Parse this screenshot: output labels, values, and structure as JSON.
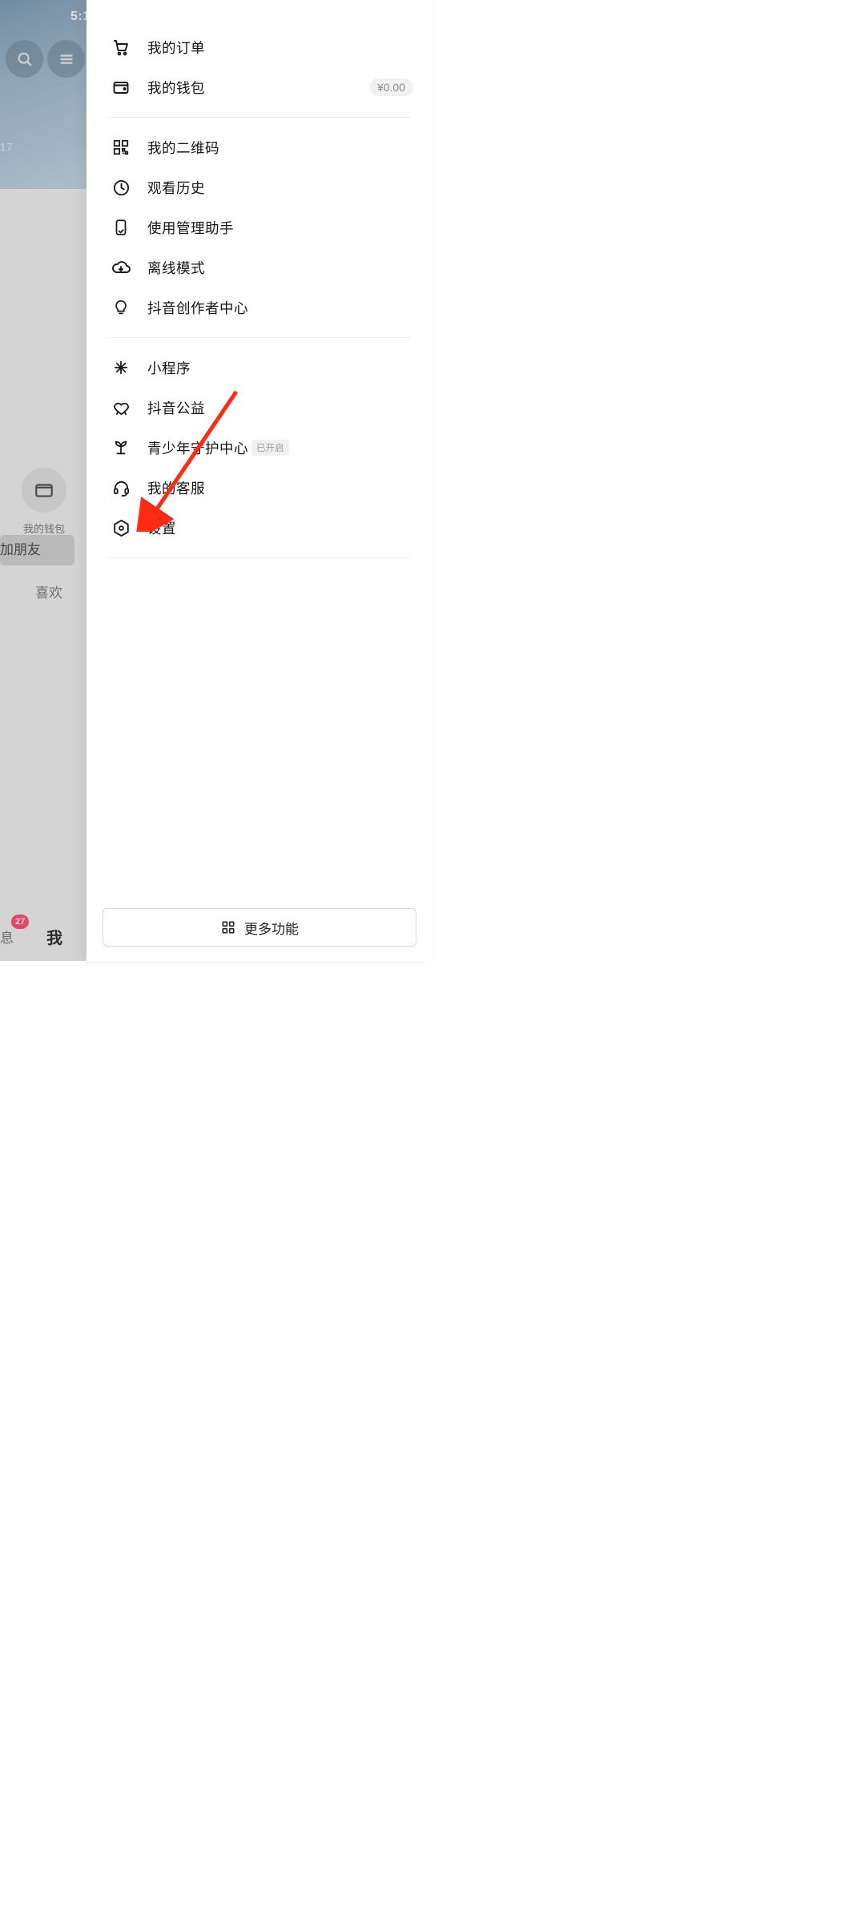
{
  "status_bar": {
    "time": "5:1"
  },
  "background": {
    "views_text": "17",
    "wallet_tile_label": "我的钱包",
    "add_friend_label": "加朋友",
    "like_tab": "喜欢",
    "nav_msg": "息",
    "nav_me": "我",
    "msg_badge": "27"
  },
  "drawer": {
    "group1": [
      {
        "id": "orders",
        "label": "我的订单",
        "trailing": null
      },
      {
        "id": "wallet",
        "label": "我的钱包",
        "trailing": "¥0.00"
      }
    ],
    "group2": [
      {
        "id": "qrcode",
        "label": "我的二维码"
      },
      {
        "id": "history",
        "label": "观看历史"
      },
      {
        "id": "usage",
        "label": "使用管理助手"
      },
      {
        "id": "offline",
        "label": "离线模式"
      },
      {
        "id": "creator",
        "label": "抖音创作者中心"
      }
    ],
    "group3": [
      {
        "id": "miniapp",
        "label": "小程序"
      },
      {
        "id": "charity",
        "label": "抖音公益"
      },
      {
        "id": "youth",
        "label": "青少年守护中心",
        "tag": "已开启"
      },
      {
        "id": "support",
        "label": "我的客服"
      },
      {
        "id": "settings",
        "label": "设置"
      }
    ],
    "more_button": "更多功能"
  }
}
